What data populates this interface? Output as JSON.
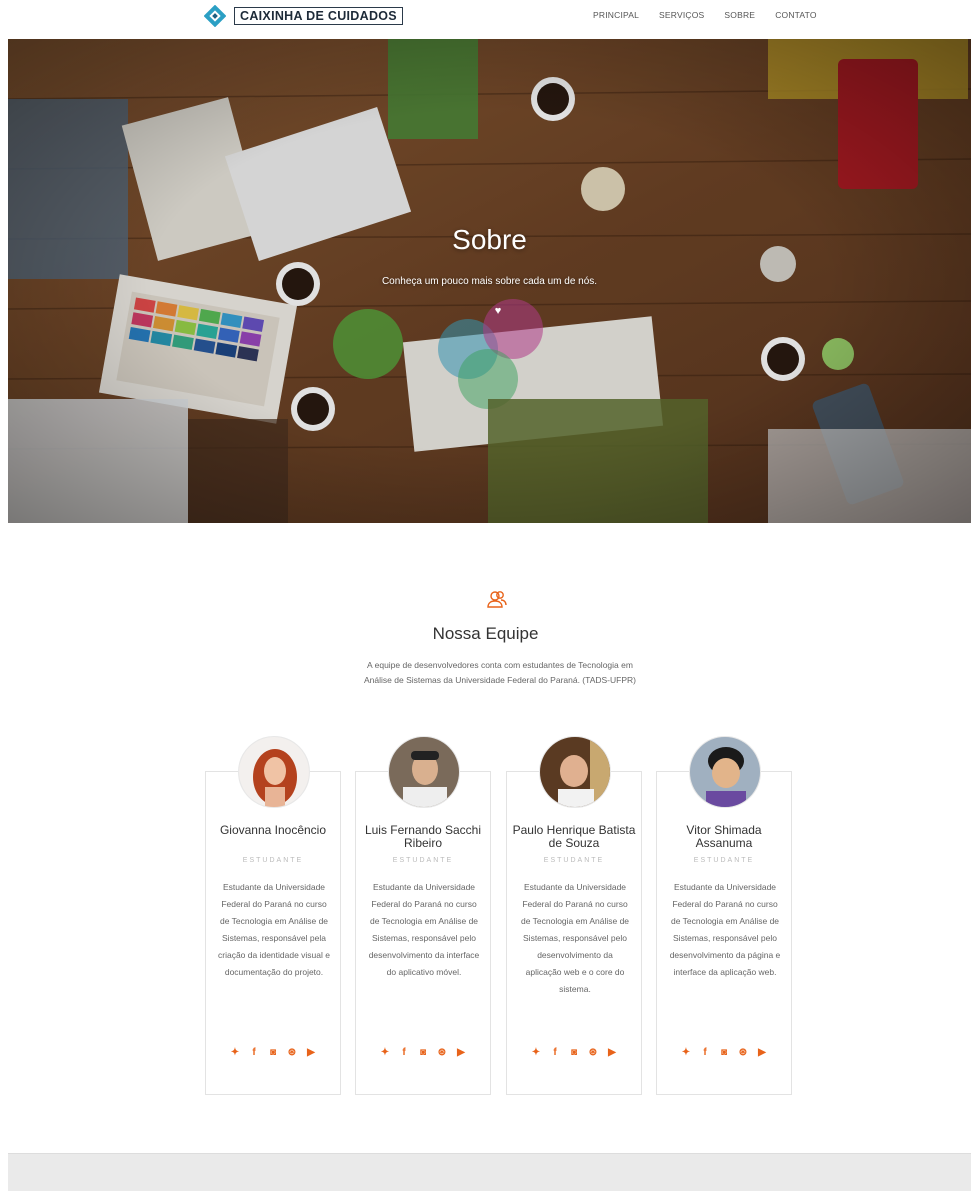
{
  "header": {
    "brand": "CAIXINHA DE CUIDADOS",
    "menu": [
      "PRINCIPAL",
      "SERVIÇOS",
      "SOBRE",
      "CONTATO"
    ]
  },
  "hero": {
    "title": "Sobre",
    "subtitle": "Conheça um pouco mais sobre cada um de nós.",
    "icon": "heart-icon"
  },
  "team": {
    "icon": "users-icon",
    "title": "Nossa Equipe",
    "description": "A equipe de desenvolvedores conta com estudantes de Tecnologia em Análise de Sistemas da Universidade Federal do Paraná. (TADS-UFPR)",
    "members": [
      {
        "name": "Giovanna Inocêncio",
        "role": "ESTUDANTE",
        "bio": "Estudante da Universidade Federal do Paraná no curso de Tecnologia em Análise de Sistemas, responsável pela criação da identidade visual e documentação do projeto."
      },
      {
        "name": "Luis Fernando Sacchi Ribeiro",
        "role": "ESTUDANTE",
        "bio": "Estudante da Universidade Federal do Paraná no curso de Tecnologia em Análise de Sistemas, responsável pelo desenvolvimento da interface do aplicativo móvel."
      },
      {
        "name": "Paulo Henrique Batista de Souza",
        "role": "ESTUDANTE",
        "bio": "Estudante da Universidade Federal do Paraná no curso de Tecnologia em Análise de Sistemas, responsável pelo desenvolvimento da aplicação web e o core do sistema."
      },
      {
        "name": "Vitor Shimada Assanuma",
        "role": "ESTUDANTE",
        "bio": "Estudante da Universidade Federal do Paraná no curso de Tecnologia em Análise de Sistemas, responsável pelo desenvolvimento da página e interface da aplicação web."
      }
    ],
    "social_icons": [
      "twitter-icon",
      "facebook-icon",
      "instagram-icon",
      "dribbble-icon",
      "youtube-icon"
    ]
  },
  "colors": {
    "accent": "#e8631a",
    "brand": "#2b9fc4"
  }
}
